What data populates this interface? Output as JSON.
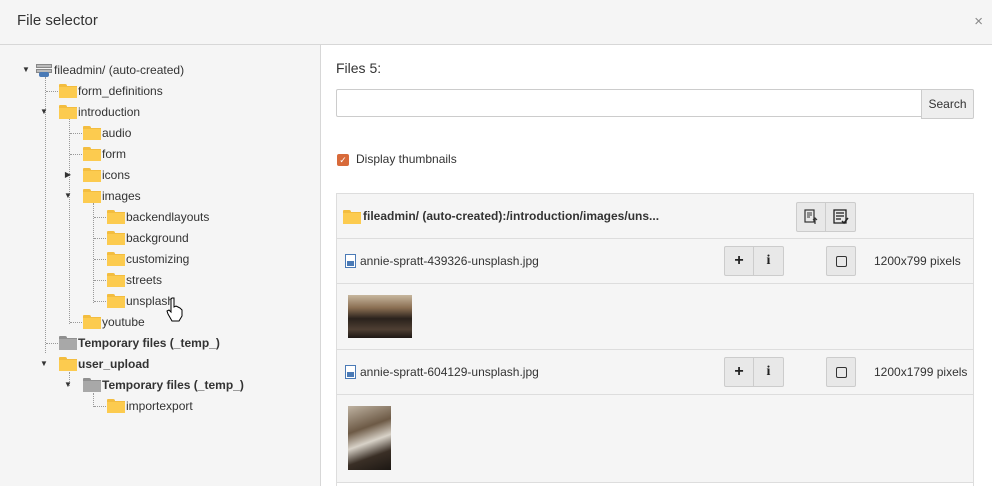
{
  "window": {
    "title": "File selector",
    "close_glyph": "×"
  },
  "tree": {
    "items": [
      {
        "label": "fileadmin/ (auto-created)",
        "icon": "storage-icon",
        "bold": false
      },
      {
        "label": "form_definitions",
        "icon": "folder-icon"
      },
      {
        "label": "introduction",
        "icon": "folder-icon"
      },
      {
        "label": "audio",
        "icon": "folder-icon"
      },
      {
        "label": "form",
        "icon": "folder-icon"
      },
      {
        "label": "icons",
        "icon": "folder-icon"
      },
      {
        "label": "images",
        "icon": "folder-icon"
      },
      {
        "label": "backendlayouts",
        "icon": "folder-icon"
      },
      {
        "label": "background",
        "icon": "folder-icon"
      },
      {
        "label": "customizing",
        "icon": "folder-icon"
      },
      {
        "label": "streets",
        "icon": "folder-icon"
      },
      {
        "label": "unsplash",
        "icon": "folder-icon"
      },
      {
        "label": "youtube",
        "icon": "folder-icon"
      },
      {
        "label": "Temporary files (_temp_)",
        "icon": "folder-gray-icon",
        "bold": true
      },
      {
        "label": "user_upload",
        "icon": "folder-icon",
        "bold": true
      },
      {
        "label": "Temporary files (_temp_)",
        "icon": "folder-gray-icon",
        "bold": true
      },
      {
        "label": "importexport",
        "icon": "folder-icon"
      }
    ]
  },
  "main": {
    "files_label": "Files 5:",
    "search": {
      "value": "",
      "placeholder": "",
      "button_label": "Search"
    },
    "thumbnails": {
      "label": "Display thumbnails",
      "checked": true
    },
    "table": {
      "path": "fileadmin/ (auto-created):/introduction/images/uns...",
      "files": [
        {
          "name": "annie-spratt-439326-unsplash.jpg",
          "dims": "1200x799 pixels"
        },
        {
          "name": "annie-spratt-604129-unsplash.jpg",
          "dims": "1200x1799 pixels"
        }
      ]
    }
  },
  "colors": {
    "folder": "#fccb4f",
    "accent": "#d86a3a",
    "panel": "#f5f5f5"
  }
}
